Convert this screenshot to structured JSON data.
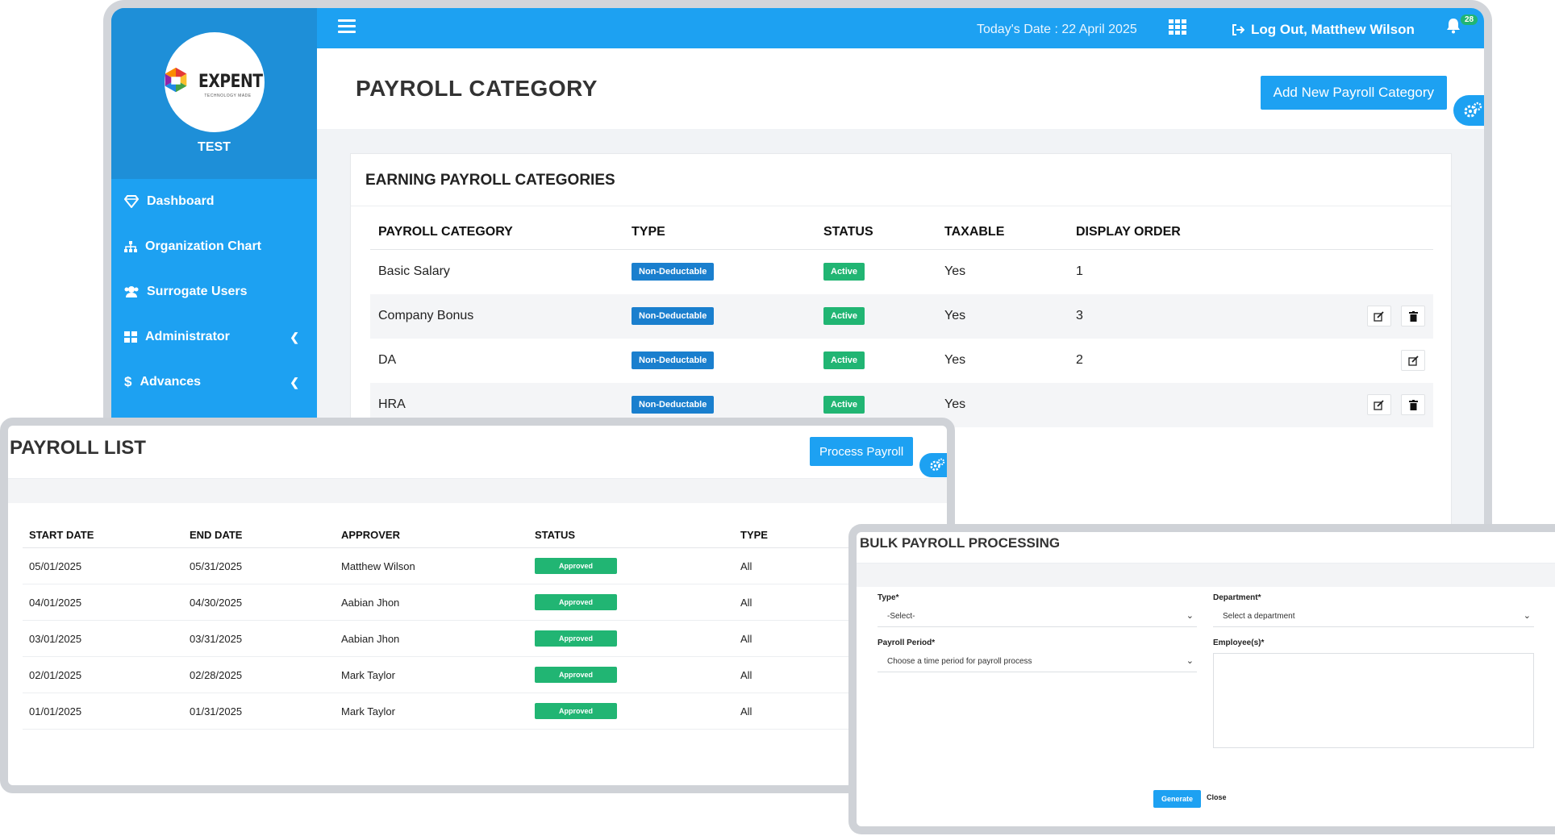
{
  "brand": {
    "logo_text": "EXPENT",
    "logo_sub": "TECHNOLOGY MADE",
    "org": "TEST"
  },
  "sidebar": {
    "items": [
      {
        "label": "Dashboard",
        "icon": "diamond-icon",
        "has_chevron": false
      },
      {
        "label": "Organization Chart",
        "icon": "sitemap-icon",
        "has_chevron": false
      },
      {
        "label": "Surrogate Users",
        "icon": "users-icon",
        "has_chevron": false
      },
      {
        "label": "Administrator",
        "icon": "grid-icon",
        "has_chevron": true
      },
      {
        "label": "Advances",
        "icon": "dollar-icon",
        "has_chevron": true
      }
    ]
  },
  "topbar": {
    "date": "Today's Date : 22 April 2025",
    "logout": "Log Out, Matthew Wilson",
    "notifications": "28"
  },
  "page": {
    "title": "PAYROLL CATEGORY",
    "add_button": "Add New Payroll Category"
  },
  "earning": {
    "title": "EARNING PAYROLL CATEGORIES",
    "headers": [
      "PAYROLL CATEGORY",
      "TYPE",
      "STATUS",
      "TAXABLE",
      "DISPLAY ORDER"
    ],
    "rows": [
      {
        "name": "Basic Salary",
        "type": "Non-Deductable",
        "status": "Active",
        "taxable": "Yes",
        "order": "1",
        "actions": []
      },
      {
        "name": "Company Bonus",
        "type": "Non-Deductable",
        "status": "Active",
        "taxable": "Yes",
        "order": "3",
        "actions": [
          "edit",
          "delete"
        ]
      },
      {
        "name": "DA",
        "type": "Non-Deductable",
        "status": "Active",
        "taxable": "Yes",
        "order": "2",
        "actions": [
          "edit"
        ]
      },
      {
        "name": "HRA",
        "type": "Non-Deductable",
        "status": "Active",
        "taxable": "Yes",
        "order": "",
        "actions": [
          "edit",
          "delete"
        ]
      }
    ]
  },
  "payroll_list": {
    "title": "PAYROLL LIST",
    "process_button": "Process Payroll",
    "headers": [
      "START DATE",
      "END DATE",
      "APPROVER",
      "STATUS",
      "TYPE"
    ],
    "rows": [
      {
        "start": "05/01/2025",
        "end": "05/31/2025",
        "approver": "Matthew Wilson",
        "status": "Approved",
        "type": "All"
      },
      {
        "start": "04/01/2025",
        "end": "04/30/2025",
        "approver": "Aabian Jhon",
        "status": "Approved",
        "type": "All"
      },
      {
        "start": "03/01/2025",
        "end": "03/31/2025",
        "approver": "Aabian Jhon",
        "status": "Approved",
        "type": "All"
      },
      {
        "start": "02/01/2025",
        "end": "02/28/2025",
        "approver": "Mark Taylor",
        "status": "Approved",
        "type": "All"
      },
      {
        "start": "01/01/2025",
        "end": "01/31/2025",
        "approver": "Mark Taylor",
        "status": "Approved",
        "type": "All"
      }
    ]
  },
  "bulk": {
    "title": "BULK PAYROLL PROCESSING",
    "type_label": "Type*",
    "type_value": "-Select-",
    "dept_label": "Department*",
    "dept_value": "Select a department",
    "period_label": "Payroll Period*",
    "period_value": "Choose a time period for payroll process",
    "employees_label": "Employee(s)*",
    "generate": "Generate",
    "close": "Close"
  },
  "colors": {
    "primary": "#1da1f2",
    "sidebar_head": "#1e8fd8",
    "success": "#21b573",
    "info": "#1a7fce"
  }
}
